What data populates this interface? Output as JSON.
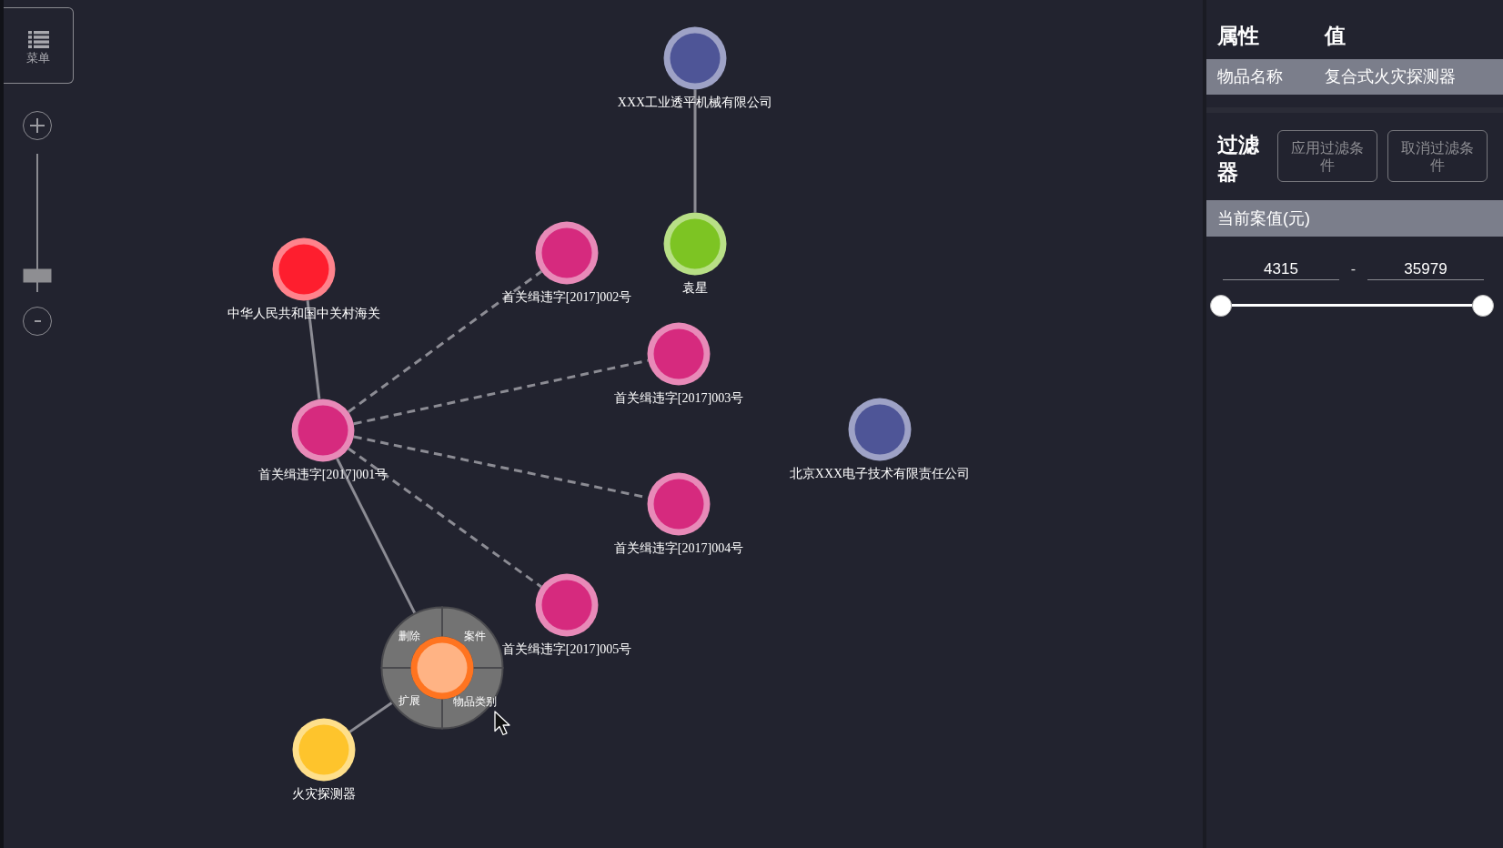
{
  "toolbar": {
    "menu_label": "菜单",
    "zoom_slider": {
      "level": 0.12
    }
  },
  "graph": {
    "nodes": [
      {
        "label": "XXX工业透平机械有限公司",
        "color": "#4e5597",
        "selected": false,
        "children": [
          {
            "label": "袁星",
            "color": "#7dc423",
            "selected": false,
            "dashed": false
          }
        ]
      },
      {
        "label": "中华人民共和国中关村海关",
        "color": "#fe1e2e",
        "selected": false,
        "children": [
          {
            "label": "首关缉违字[2017]001号",
            "color": "#d62a7e",
            "selected": false,
            "dashed": false,
            "children": [
              {
                "label": "首关缉违字[2017]002号",
                "color": "#d62a7e",
                "selected": false,
                "dashed": true
              },
              {
                "label": "首关缉违字[2017]003号",
                "color": "#d62a7e",
                "selected": false,
                "dashed": true
              },
              {
                "label": "首关缉违字[2017]004号",
                "color": "#d62a7e",
                "selected": false,
                "dashed": true
              },
              {
                "label": "首关缉违字[2017]005号",
                "color": "#d62a7e",
                "selected": false,
                "dashed": true
              },
              {
                "color": "#ff7420",
                "selected": true,
                "dashed": false,
                "children": [
                  {
                    "label": "火灾探测器",
                    "color": "#fec42c",
                    "selected": false,
                    "dashed": false
                  }
                ]
              }
            ]
          }
        ]
      },
      {
        "label": "北京XXX电子技术有限责任公司",
        "color": "#4e5597",
        "selected": false
      }
    ],
    "node_menu": {
      "items": [
        {
          "label": "删除"
        },
        {
          "label": "案件"
        },
        {
          "label": "扩展"
        },
        {
          "label": "物品类别"
        }
      ]
    }
  },
  "properties": {
    "columns": [
      "属性",
      "值"
    ],
    "rows": [
      {
        "name": "物品名称",
        "value": "复合式火灾探测器"
      }
    ]
  },
  "filter": {
    "title": "过滤器",
    "buttons": [
      {
        "label": "应用过滤条件"
      },
      {
        "label": "取消过滤条件"
      }
    ],
    "fields": [
      {
        "title": "当前案值(元)",
        "min": "4315",
        "separator": "-",
        "max": "35979",
        "handles": [
          {
            "level": 0
          },
          {
            "level": 1
          }
        ]
      }
    ]
  }
}
